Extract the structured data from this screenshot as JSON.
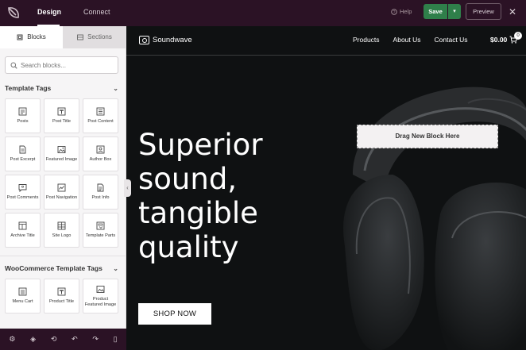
{
  "topbar": {
    "tabs": [
      "Design",
      "Connect"
    ],
    "help_label": "Help",
    "save_label": "Save",
    "preview_label": "Preview"
  },
  "sidebar": {
    "tabs": [
      "Blocks",
      "Sections"
    ],
    "search_placeholder": "Search blocks...",
    "sections": [
      {
        "title": "Template Tags",
        "blocks": [
          {
            "label": "Posts",
            "icon": "posts-icon"
          },
          {
            "label": "Post Title",
            "icon": "post-title-icon"
          },
          {
            "label": "Post Content",
            "icon": "post-content-icon"
          },
          {
            "label": "Post Excerpt",
            "icon": "post-excerpt-icon"
          },
          {
            "label": "Featured Image",
            "icon": "featured-image-icon"
          },
          {
            "label": "Author Box",
            "icon": "author-box-icon"
          },
          {
            "label": "Post Comments",
            "icon": "post-comments-icon"
          },
          {
            "label": "Post Navigation",
            "icon": "post-navigation-icon"
          },
          {
            "label": "Post Info",
            "icon": "post-info-icon"
          },
          {
            "label": "Archive Title",
            "icon": "archive-title-icon"
          },
          {
            "label": "Site Logo",
            "icon": "site-logo-icon"
          },
          {
            "label": "Template Parts",
            "icon": "template-parts-icon"
          }
        ]
      },
      {
        "title": "WooCommerce Template Tags",
        "blocks": [
          {
            "label": "Menu Cart",
            "icon": "menu-cart-icon"
          },
          {
            "label": "Product Title",
            "icon": "product-title-icon"
          },
          {
            "label": "Product Featured Image",
            "icon": "product-featured-image-icon"
          }
        ]
      }
    ]
  },
  "canvas": {
    "brand": "Soundwave",
    "nav": [
      "Products",
      "About Us",
      "Contact Us"
    ],
    "cart_total": "$0.00",
    "cart_count": "0",
    "headline_lines": [
      "Superior",
      "sound,",
      "tangible",
      "quality"
    ],
    "cta_label": "SHOP NOW",
    "dropzone_label": "Drag New Block Here"
  }
}
